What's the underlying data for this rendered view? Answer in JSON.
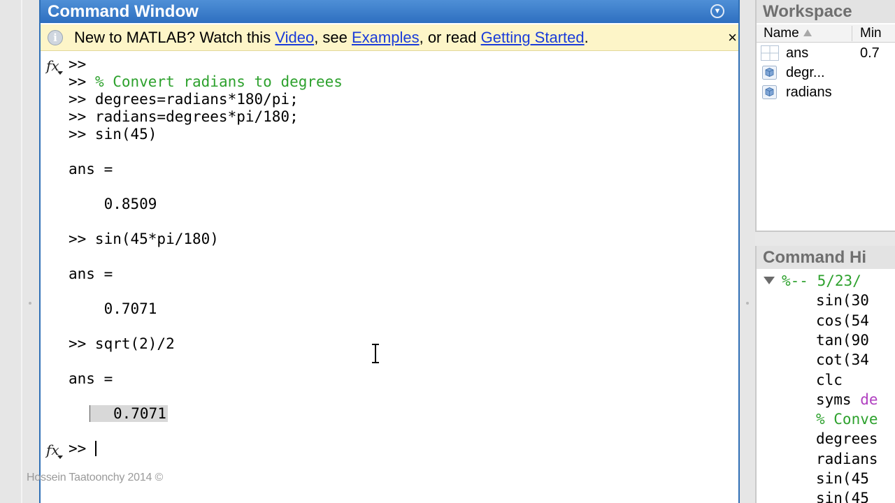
{
  "command_window": {
    "title": "Command Window",
    "info": {
      "prefix": "New to MATLAB? Watch this ",
      "video_link": "Video",
      "mid1": ", see ",
      "examples_link": "Examples",
      "mid2": ", or read ",
      "getting_started_link": "Getting Started",
      "suffix": ".",
      "close": "×"
    },
    "fx_label": "fx",
    "lines": [
      ">>",
      ">> ",
      ">> degrees=radians*180/pi;",
      ">> radians=degrees*pi/180;",
      ">> sin(45)",
      "",
      "ans =",
      "",
      "    0.8509",
      "",
      ">> sin(45*pi/180)",
      "",
      "ans =",
      "",
      "    0.7071",
      "",
      ">> sqrt(2)/2",
      "",
      "ans =",
      "",
      "0.7071"
    ],
    "comment_text": "% Convert radians to degrees",
    "prompt": ">> "
  },
  "watermark": "Hossein Taatoonchy 2014 ©",
  "workspace": {
    "title": "Workspace",
    "columns": {
      "name": "Name",
      "min": "Min"
    },
    "rows": [
      {
        "name": "ans",
        "min": "0.7",
        "icon": "matrix-icon"
      },
      {
        "name": "degr...",
        "min": "",
        "icon": "sym-object-icon"
      },
      {
        "name": "radians",
        "min": "",
        "icon": "sym-object-icon"
      }
    ]
  },
  "history": {
    "title": "Command Hi",
    "session": "%-- 5/23/",
    "items": [
      "sin(30",
      "cos(54",
      "tan(90",
      "cot(34",
      "clc",
      "syms ",
      "% Conve",
      "degrees",
      "radians",
      "sin(45",
      "sin(45"
    ],
    "syms_arg": "de"
  },
  "colors": {
    "title_bar": "#2e6fc0",
    "info_bar": "#fdf5c8",
    "link": "#1a3bd9",
    "comment": "#2da12d",
    "string": "#b040c0"
  }
}
